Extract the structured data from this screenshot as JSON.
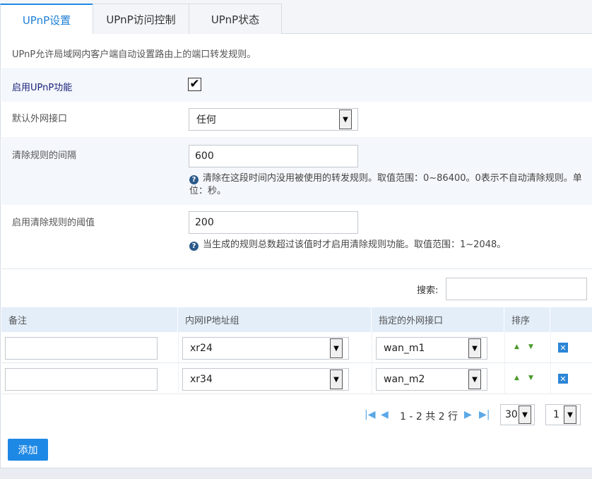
{
  "tabs": [
    {
      "label": "UPnP设置",
      "active": true
    },
    {
      "label": "UPnP访问控制",
      "active": false
    },
    {
      "label": "UPnP状态",
      "active": false
    }
  ],
  "description": "UPnP允许局域网内客户端自动设置路由上的端口转发规则。",
  "form": {
    "enable_label": "启用UPnP功能",
    "enable_checked": true,
    "check_glyph": "✔",
    "wan_label": "默认外网接口",
    "wan_value": "任何",
    "interval_label": "清除规则的间隔",
    "interval_value": "600",
    "interval_hint": "清除在这段时间内没用被使用的转发规则。取值范围：0~86400。0表示不自动清除规则。单位：秒。",
    "threshold_label": "启用清除规则的阈值",
    "threshold_value": "200",
    "threshold_hint": "当生成的规则总数超过该值时才启用清除规则功能。取值范围：1~2048。"
  },
  "search": {
    "label": "搜索:",
    "value": ""
  },
  "table": {
    "headers": [
      "备注",
      "内网IP地址组",
      "指定的外网接口",
      "排序",
      ""
    ],
    "rows": [
      {
        "note": "",
        "ip_group": "xr24",
        "wan": "wan_m1"
      },
      {
        "note": "",
        "ip_group": "xr34",
        "wan": "wan_m2"
      }
    ]
  },
  "pager": {
    "summary": "1 - 2 共 2 行",
    "page_size": "30",
    "page": "1"
  },
  "buttons": {
    "add": "添加"
  },
  "icons": {
    "first": "first-page-icon",
    "prev": "prev-page-icon",
    "next": "next-page-icon",
    "last": "last-page-icon",
    "move_up": "move-up-icon",
    "move_down": "move-down-icon",
    "delete": "delete-icon",
    "help": "help-icon",
    "dropdown": "chevron-down-icon"
  },
  "colors": {
    "accent": "#1e88e5",
    "header_bg": "#e3eef9"
  }
}
